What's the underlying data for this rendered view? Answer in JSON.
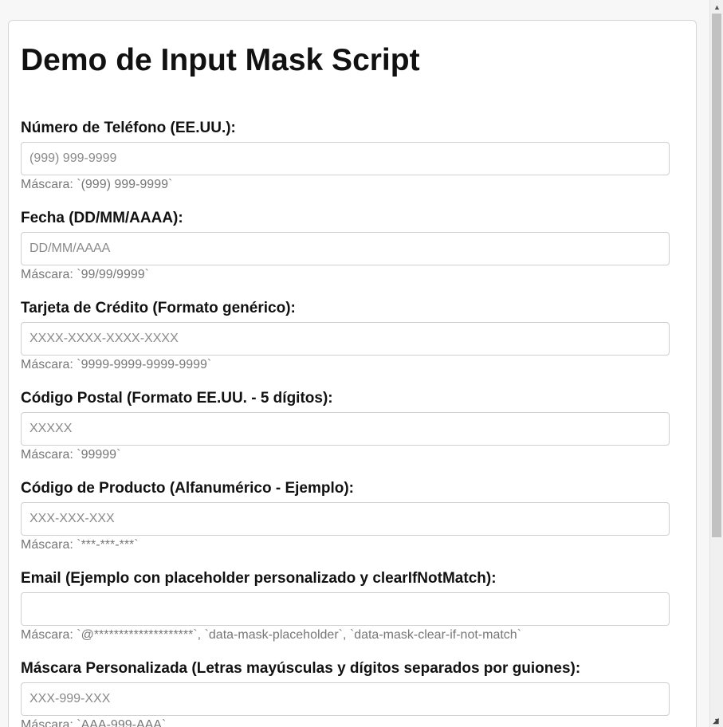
{
  "page": {
    "title": "Demo de Input Mask Script"
  },
  "fields": [
    {
      "label": "Número de Teléfono (EE.UU.):",
      "value": "",
      "placeholder": "(999) 999-9999",
      "hint": "Máscara: `(999) 999-9999`"
    },
    {
      "label": "Fecha (DD/MM/AAAA):",
      "value": "",
      "placeholder": "DD/MM/AAAA",
      "hint": "Máscara: `99/99/9999`"
    },
    {
      "label": "Tarjeta de Crédito (Formato genérico):",
      "value": "",
      "placeholder": "XXXX-XXXX-XXXX-XXXX",
      "hint": "Máscara: `9999-9999-9999-9999`"
    },
    {
      "label": "Código Postal (Formato EE.UU. - 5 dígitos):",
      "value": "",
      "placeholder": "XXXXX",
      "hint": "Máscara: `99999`"
    },
    {
      "label": "Código de Producto (Alfanumérico - Ejemplo):",
      "value": "",
      "placeholder": "XXX-XXX-XXX",
      "hint": "Máscara: `***-***-***`"
    },
    {
      "label": "Email (Ejemplo con placeholder personalizado y clearIfNotMatch):",
      "value": "",
      "placeholder": "",
      "hint": "Máscara: `@********************`, `data-mask-placeholder`, `data-mask-clear-if-not-match`"
    },
    {
      "label": "Máscara Personalizada (Letras mayúsculas y dígitos separados por guiones):",
      "value": "",
      "placeholder": "XXX-999-XXX",
      "hint": "Máscara: `AAA-999-AAA`"
    }
  ],
  "scrollbar": {
    "up_icon": "triangle-up-icon",
    "down_icon": "triangle-down-icon"
  }
}
